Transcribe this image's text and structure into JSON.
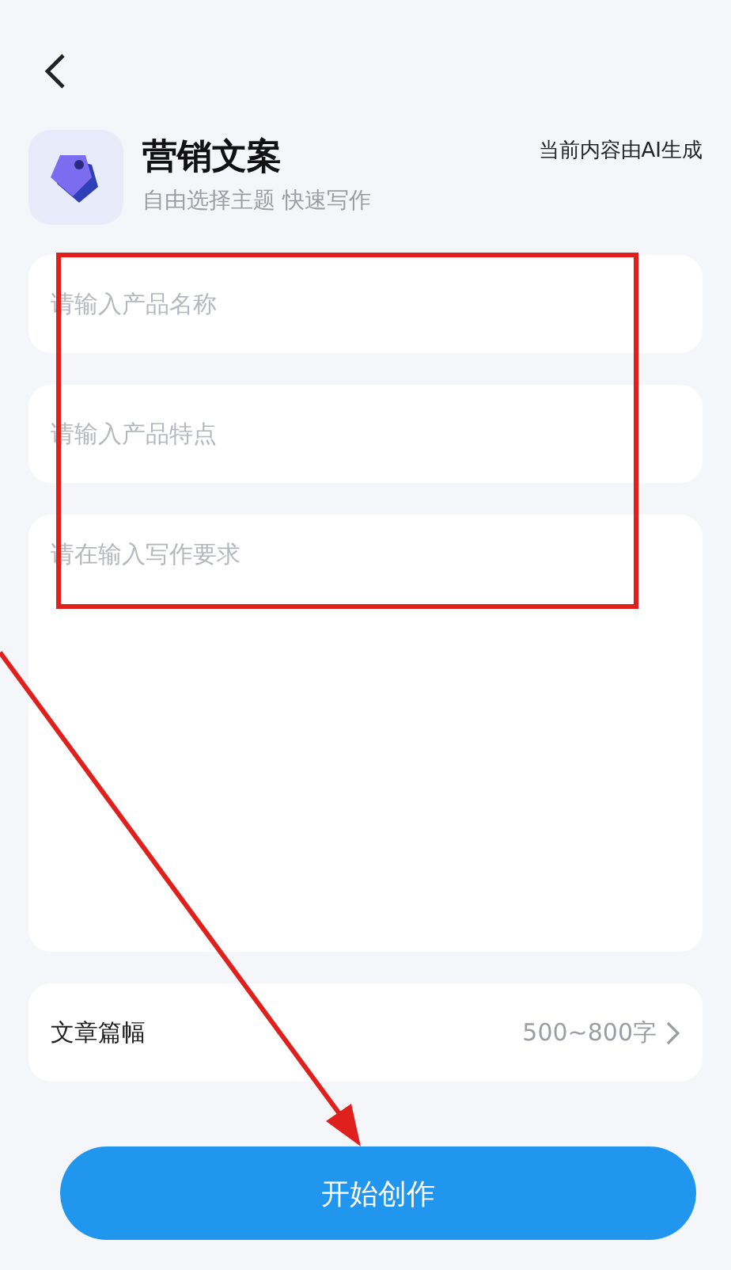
{
  "header": {
    "title": "营销文案",
    "subtitle": "自由选择主题 快速写作",
    "notice": "当前内容由AI生成"
  },
  "fields": [
    {
      "kind": "input",
      "placeholder": "请输入产品名称"
    },
    {
      "kind": "input",
      "placeholder": "请输入产品特点"
    },
    {
      "kind": "textarea",
      "placeholder": "请在输入写作要求"
    }
  ],
  "length_setting": {
    "label": "文章篇幅",
    "value": "500~800字"
  },
  "start_button": {
    "label": "开始创作"
  }
}
